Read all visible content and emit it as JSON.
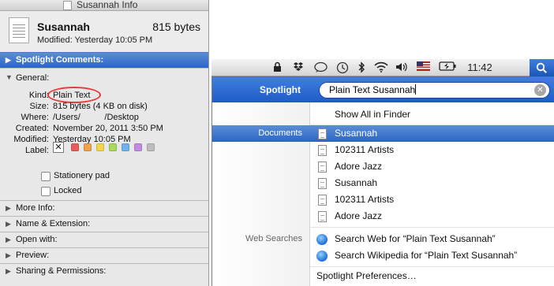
{
  "info": {
    "window_title": "Susannah Info",
    "file_name": "Susannah",
    "file_size": "815 bytes",
    "modified_line": "Modified: Yesterday 10:05 PM",
    "spotlight_comments": "Spotlight Comments:",
    "general": {
      "heading": "General:",
      "rows": [
        {
          "key": "Kind:",
          "value": "Plain Text"
        },
        {
          "key": "Size:",
          "value": "815 bytes (4 KB on disk)"
        },
        {
          "key": "Where:",
          "value": "/Users/          /Desktop"
        },
        {
          "key": "Created:",
          "value": "November 20, 2011 3:50 PM"
        },
        {
          "key": "Modified:",
          "value": "Yesterday 10:05 PM"
        },
        {
          "key": "Label:",
          "value": ""
        }
      ],
      "label_clear": "✕",
      "label_colors": [
        "#e85c5c",
        "#f0a24b",
        "#f2d64a",
        "#a9d85a",
        "#6fb3ea",
        "#c08be0",
        "#bdbdbd"
      ],
      "stationery_pad": "Stationery pad",
      "locked": "Locked"
    },
    "sections": [
      "More Info:",
      "Name & Extension:",
      "Open with:",
      "Preview:",
      "Sharing & Permissions:"
    ]
  },
  "menubar": {
    "clock": "11:42"
  },
  "spotlight": {
    "label": "Spotlight",
    "query": "Plain Text Susannah",
    "show_all": "Show All in Finder",
    "category_documents": "Documents",
    "category_web": "Web Searches",
    "documents": [
      "Susannah",
      "102311 Artists",
      "Adore Jazz",
      "Susannah",
      "102311 Artists",
      "Adore Jazz"
    ],
    "web": [
      "Search Web for “Plain Text Susannah”",
      "Search Wikipedia for “Plain Text Susannah”"
    ],
    "preferences": "Spotlight Preferences…"
  },
  "colors": {
    "selection_blue": "#2b65c6",
    "highlight_red": "#e83a3a"
  }
}
